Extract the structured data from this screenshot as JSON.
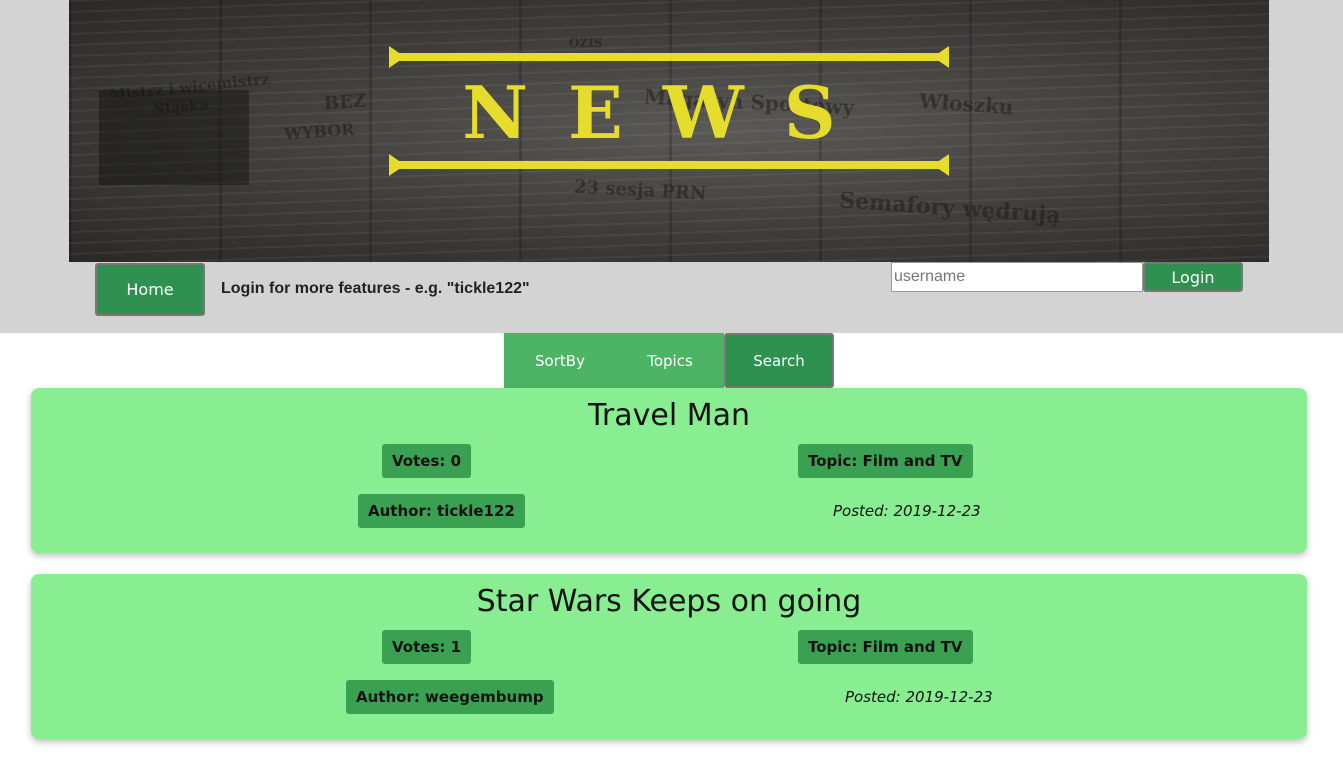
{
  "banner": {
    "logo_text": "NEWS",
    "logo_color": "#e5dc2b",
    "newspaper_snippets": [
      "Mistrz i wicemistrz",
      "Śląska",
      "BEZ",
      "WYBOR",
      "Magazyn Sportowy",
      "Włoszku",
      "23 sesja PRN",
      "Semafory wędrują",
      "OZIS"
    ]
  },
  "header": {
    "home_label": "Home",
    "login_hint": "Login for more features - e.g. \"tickle122\"",
    "username_placeholder": "username",
    "login_label": "Login",
    "background_color": "#d3d3d3"
  },
  "nav": {
    "sortby_label": "SortBy",
    "topics_label": "Topics",
    "search_label": "Search"
  },
  "articles": [
    {
      "title": "Travel Man",
      "votes": "Votes: 0",
      "topic": "Topic: Film and TV",
      "author": "Author: tickle122",
      "posted": "Posted: 2019-12-23"
    },
    {
      "title": "Star Wars Keeps on going",
      "votes": "Votes: 1",
      "topic": "Topic: Film and TV",
      "author": "Author: weegembump",
      "posted": "Posted: 2019-12-23"
    }
  ],
  "colors": {
    "button_green": "#2e9150",
    "nav_green": "#4cb464",
    "card_green": "#88ee91",
    "pill_green": "#3aa152"
  }
}
